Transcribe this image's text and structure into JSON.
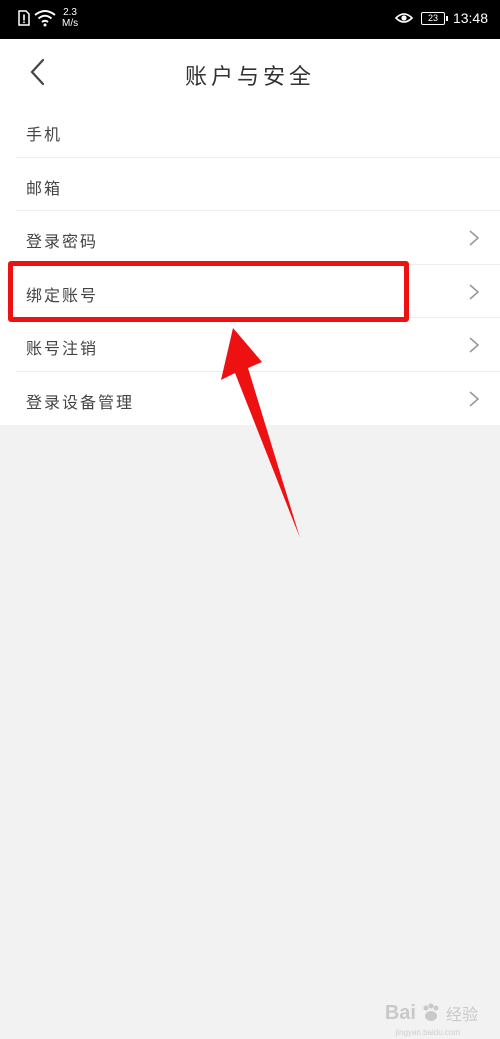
{
  "status_bar": {
    "speed_value": "2.3",
    "speed_unit": "M/s",
    "battery": "23",
    "time": "13:48"
  },
  "header": {
    "title": "账户与安全",
    "back_icon": "chevron-left-icon"
  },
  "list": [
    {
      "label": "手机",
      "chevron": false
    },
    {
      "label": "邮箱",
      "chevron": false
    },
    {
      "label": "登录密码",
      "chevron": true
    },
    {
      "label": "绑定账号",
      "chevron": true
    },
    {
      "label": "账号注销",
      "chevron": true
    },
    {
      "label": "登录设备管理",
      "chevron": true
    }
  ],
  "annotation": {
    "highlight_color": "#ee1111",
    "highlighted_item": "绑定账号"
  },
  "watermark": {
    "brand": "Bai",
    "suffix": "经验",
    "url": "jingyan.baidu.com"
  }
}
